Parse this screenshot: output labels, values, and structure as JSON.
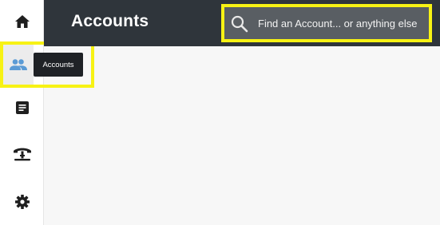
{
  "header": {
    "title": "Accounts"
  },
  "search": {
    "placeholder": "Find an Account... or anything else"
  },
  "sidebar": {
    "items": [
      {
        "icon": "home-icon",
        "label": "Home"
      },
      {
        "icon": "people-icon",
        "label": "Accounts",
        "active": true
      },
      {
        "icon": "notes-icon",
        "label": "Notes"
      },
      {
        "icon": "phone-icon",
        "label": "Calls"
      },
      {
        "icon": "gear-icon",
        "label": "Settings"
      }
    ]
  },
  "tooltip": {
    "text": "Accounts"
  },
  "colors": {
    "header_bg": "#2f353b",
    "highlight": "#f7f214",
    "accent": "#5b9bd5",
    "sidebar_bg": "#ffffff",
    "content_bg": "#f7f7f7"
  }
}
